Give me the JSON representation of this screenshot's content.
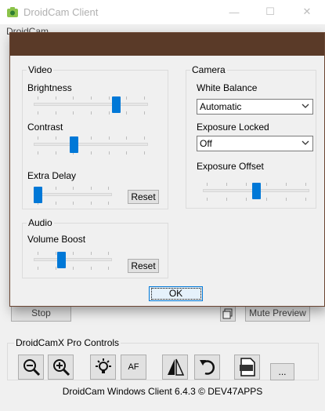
{
  "window": {
    "title": "DroidCam Client",
    "menu_partial": "DroidCam",
    "minimize": "—",
    "maximize": "☐",
    "close": "✕"
  },
  "main": {
    "stop_label": "Stop",
    "mute_preview_label": "Mute Preview",
    "pro_controls_title": "DroidCamX Pro Controls",
    "pro_buttons": {
      "zoom_out": "zoom-out-icon",
      "zoom_in": "zoom-in-icon",
      "light": "flashlight-icon",
      "autofocus": "AF",
      "mirror": "mirror-icon",
      "rotate": "rotate-icon",
      "jpg": "JPG",
      "more": "..."
    },
    "footer": "DroidCam Windows Client 6.4.3 © DEV47APPS"
  },
  "dialog": {
    "video": {
      "title": "Video",
      "brightness_label": "Brightness",
      "brightness_value": 0.74,
      "contrast_label": "Contrast",
      "contrast_value": 0.34,
      "extra_delay_label": "Extra Delay",
      "extra_delay_value": 0.0,
      "reset_label": "Reset"
    },
    "audio": {
      "title": "Audio",
      "volume_boost_label": "Volume Boost",
      "volume_boost_value": 0.34,
      "reset_label": "Reset"
    },
    "camera": {
      "title": "Camera",
      "white_balance_label": "White Balance",
      "white_balance_value": "Automatic",
      "exposure_locked_label": "Exposure Locked",
      "exposure_locked_value": "Off",
      "exposure_offset_label": "Exposure Offset",
      "exposure_offset_value": 0.5
    },
    "ok_label": "OK"
  },
  "colors": {
    "accent": "#0078d7",
    "dialog_titlebar": "#5a3a28"
  }
}
